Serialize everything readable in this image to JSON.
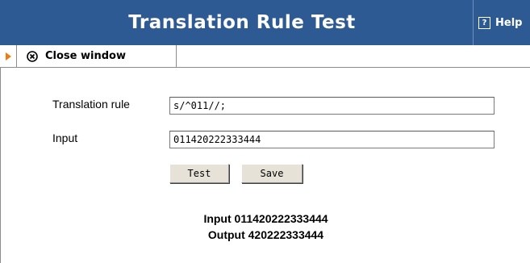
{
  "window": {
    "title": "Translation Rule Test",
    "help_label": "Help",
    "help_icon": "?"
  },
  "toolbar": {
    "close_label": "Close window"
  },
  "form": {
    "rule_label": "Translation rule",
    "rule_value": "s/^011//;",
    "input_label": "Input",
    "input_value": "011420222333444",
    "test_label": "Test",
    "save_label": "Save"
  },
  "result": {
    "input_line": "Input 011420222333444",
    "output_line": "Output 420222333444"
  },
  "colors": {
    "title_bar": "#2e5a94",
    "arrow": "#f07a10",
    "button_face": "#e6e2d8"
  }
}
